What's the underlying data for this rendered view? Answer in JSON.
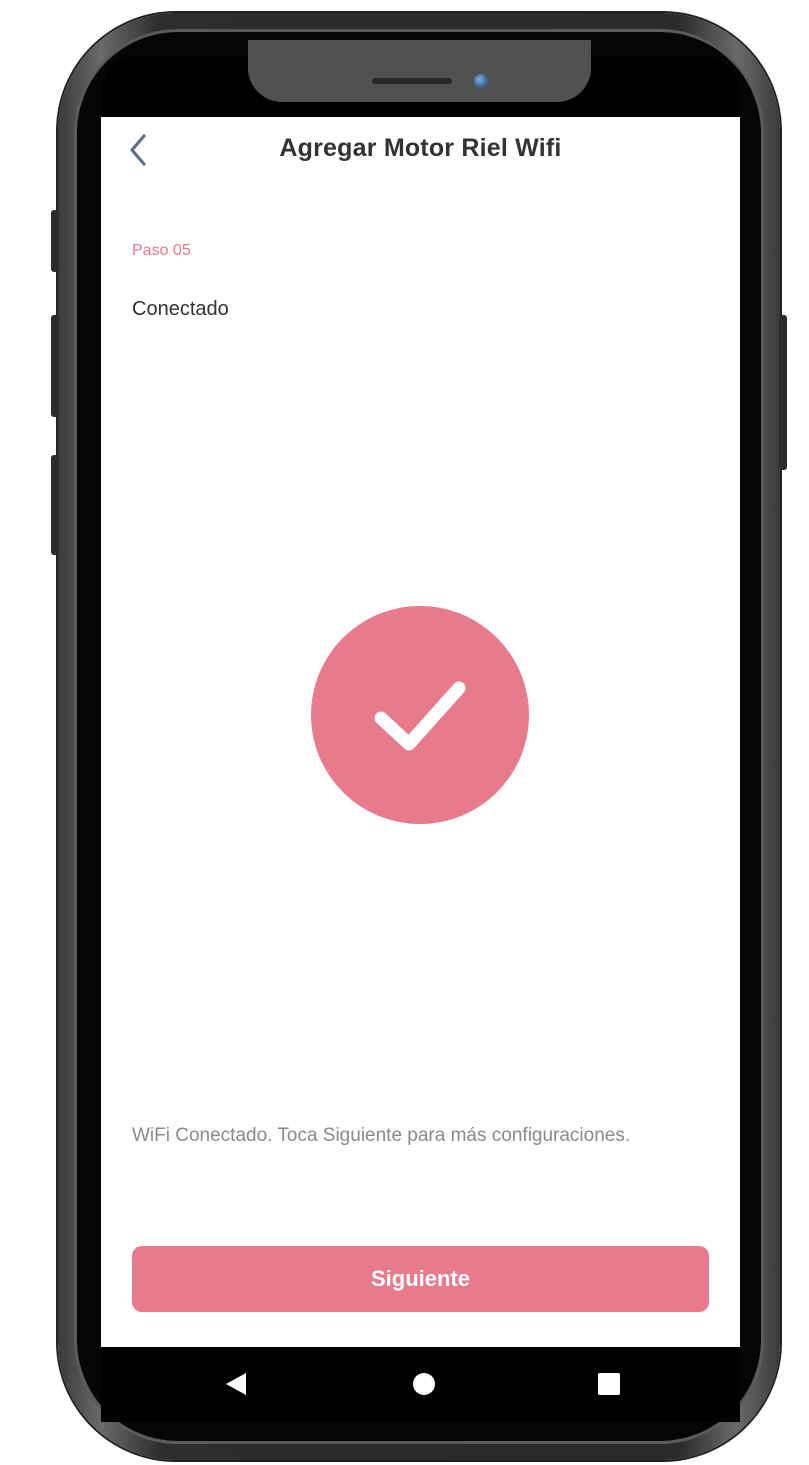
{
  "header": {
    "title": "Agregar Motor Riel Wifi",
    "back_icon": "chevron-left-icon"
  },
  "step": {
    "label": "Paso 05",
    "title": "Conectado"
  },
  "status": {
    "icon": "checkmark-circle-icon",
    "hint": "WiFi Conectado. Toca Siguiente para más configuraciones."
  },
  "actions": {
    "next_label": "Siguiente"
  },
  "navbar": {
    "icons": [
      "nav-back-icon",
      "nav-home-icon",
      "nav-recents-icon"
    ]
  },
  "colors": {
    "accent": "#e87b8b",
    "step_label": "#e67a8c",
    "title_text": "#333333",
    "hint_text": "#8a8a8a",
    "back_icon": "#5b6f8a"
  }
}
